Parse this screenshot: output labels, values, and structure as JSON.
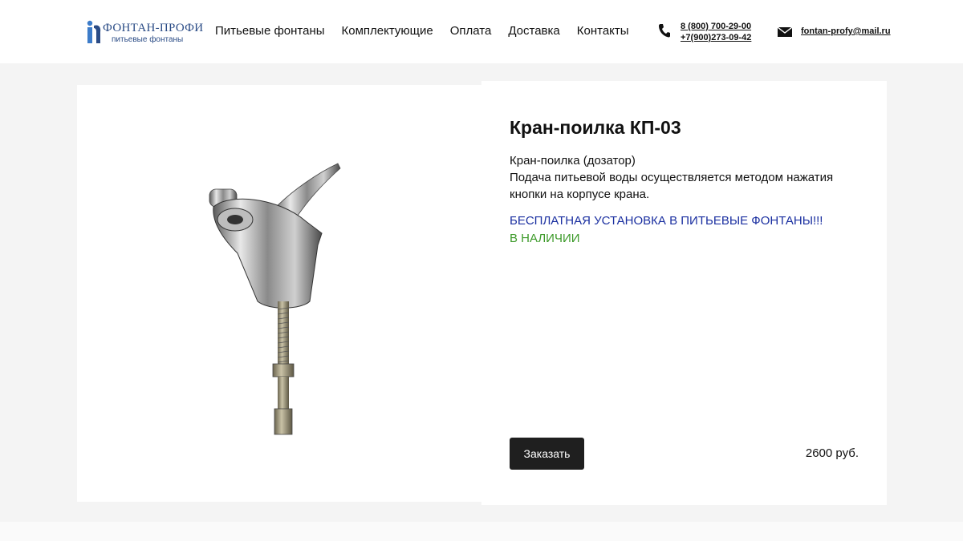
{
  "header": {
    "logo": {
      "name": "ФОНТАН-ПРОФИ",
      "tagline": "питьевые фонтаны",
      "brand_color": "#2b4c86"
    },
    "nav": [
      {
        "label": "Питьевые фонтаны"
      },
      {
        "label": "Комплектующие"
      },
      {
        "label": "Оплата"
      },
      {
        "label": "Доставка"
      },
      {
        "label": "Контакты"
      }
    ],
    "contacts": {
      "phone_icon": "phone-icon",
      "phone_1": "8 (800) 700-29-00",
      "phone_2": "+7(900)273-09-42",
      "mail_icon": "envelope-icon",
      "email": "fontan-profy@mail.ru"
    }
  },
  "product": {
    "image": "chrome-drinking-faucet",
    "title": "Кран-поилка КП-03",
    "description_line_1": "Кран-поилка (дозатор)",
    "description_line_2": "Подача питьевой воды осуществляется методом нажатия кнопки на корпусе крана.",
    "promo": "БЕСПЛАТНАЯ УСТАНОВКА В ПИТЬЕВЫЕ ФОНТАНЫ!!!",
    "stock": "В НАЛИЧИИ",
    "order_label": "Заказать",
    "price": "2600 руб."
  },
  "colors": {
    "page_bg": "#f4f4f4",
    "card_bg": "#ffffff",
    "promo": "#1a2fa0",
    "stock": "#3d9a2a",
    "button": "#1f1f1f"
  }
}
